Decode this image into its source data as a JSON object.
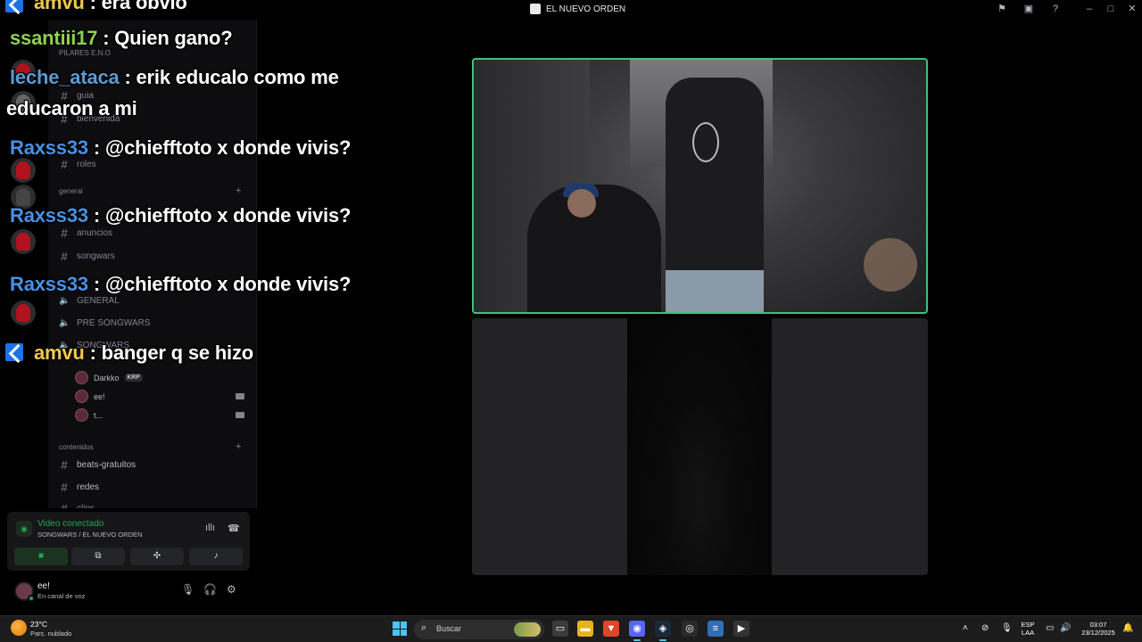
{
  "window": {
    "title": "EL NUEVO ORDEN"
  },
  "sidebar": {
    "server_header": "PILARES E.N.O",
    "channels_top": [
      {
        "label": "guia"
      },
      {
        "label": "bienvenida"
      },
      {
        "label": "roles"
      }
    ],
    "category_general": "general",
    "channels_general": [
      {
        "label": "anuncios"
      },
      {
        "label": "songwars"
      }
    ],
    "voice_channels": [
      {
        "label": "GENERAL"
      },
      {
        "label": "PRE SONGWARS"
      },
      {
        "label": "SONGWARS"
      }
    ],
    "voice_users": [
      {
        "name": "Darkko",
        "badge": "KRP"
      },
      {
        "name": "ee!"
      },
      {
        "name": "t..."
      }
    ],
    "category_contenidos": "contenidos",
    "channels_contenidos": [
      {
        "label": "beats-gratuitos"
      },
      {
        "label": "redes"
      },
      {
        "label": "clips"
      }
    ]
  },
  "voice_panel": {
    "status": "Video conectado",
    "channel": "SONGWARS / EL NUEVO ORDEN"
  },
  "user_panel": {
    "name": "ee!",
    "subtext": "En canal de voz"
  },
  "chat": {
    "messages": [
      {
        "user": "amvu",
        "text": " : era obvio",
        "user_color": "#f2c94c",
        "icon": true
      },
      {
        "user": "ssantiii17",
        "text": " : Quien gano?",
        "user_color": "#8fd14f",
        "icon": false
      },
      {
        "user": "leche_ataca",
        "text": " : erik educalo como me",
        "user_color": "#5b9bd5",
        "icon": false
      },
      {
        "user": "",
        "text": "educaron a mi",
        "user_color": "#ffffff",
        "icon": false
      },
      {
        "user": "Raxss33",
        "text": " : @chiefftoto x donde vivis?",
        "user_color": "#4a90e2",
        "icon": false
      },
      {
        "user": "Raxss33",
        "text": " : @chiefftoto x donde vivis?",
        "user_color": "#4a90e2",
        "icon": false
      },
      {
        "user": "Raxss33",
        "text": " : @chiefftoto x donde vivis?",
        "user_color": "#4a90e2",
        "icon": false
      },
      {
        "user": "amvu",
        "text": " : banger q se hizo",
        "user_color": "#f2c94c",
        "icon": true
      }
    ]
  },
  "taskbar": {
    "weather_temp": "23°C",
    "weather_desc": "Parc. nublado",
    "search_placeholder": "Buscar",
    "lang_top": "ESP",
    "lang_bottom": "LAA",
    "time": "03:07",
    "date": "23/12/2025"
  },
  "colors": {
    "speaking_border": "#3fc07a",
    "voice_connected": "#23a55a",
    "accent": "#4cc2ff"
  },
  "icons": {
    "app": "discord-logo-icon",
    "inbox": "inbox-icon",
    "help": "help-icon"
  }
}
